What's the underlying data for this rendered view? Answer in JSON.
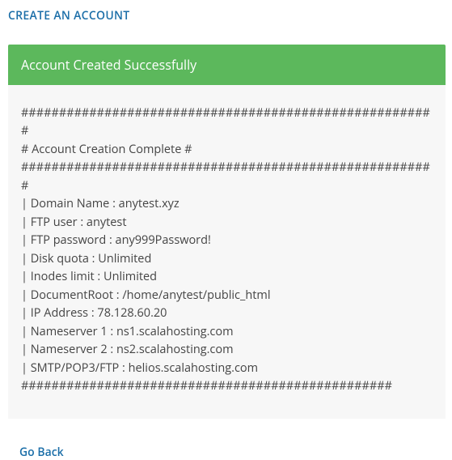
{
  "header": {
    "title": "CREATE AN ACCOUNT"
  },
  "banner": {
    "message": "Account Created Successfully"
  },
  "output": {
    "text": "#######################################################\n# Account Creation Complete #\n#######################################################\n| Domain Name : anytest.xyz\n| FTP user : anytest\n| FTP password : any999Password!\n| Disk quota : Unlimited\n| Inodes limit : Unlimited\n| DocumentRoot : /home/anytest/public_html\n| IP Address : 78.128.60.20\n| Nameserver 1 : ns1.scalahosting.com\n| Nameserver 2 : ns2.scalahosting.com\n| SMTP/POP3/FTP : helios.scalahosting.com\n#################################################"
  },
  "footer": {
    "go_back_label": "Go Back"
  }
}
